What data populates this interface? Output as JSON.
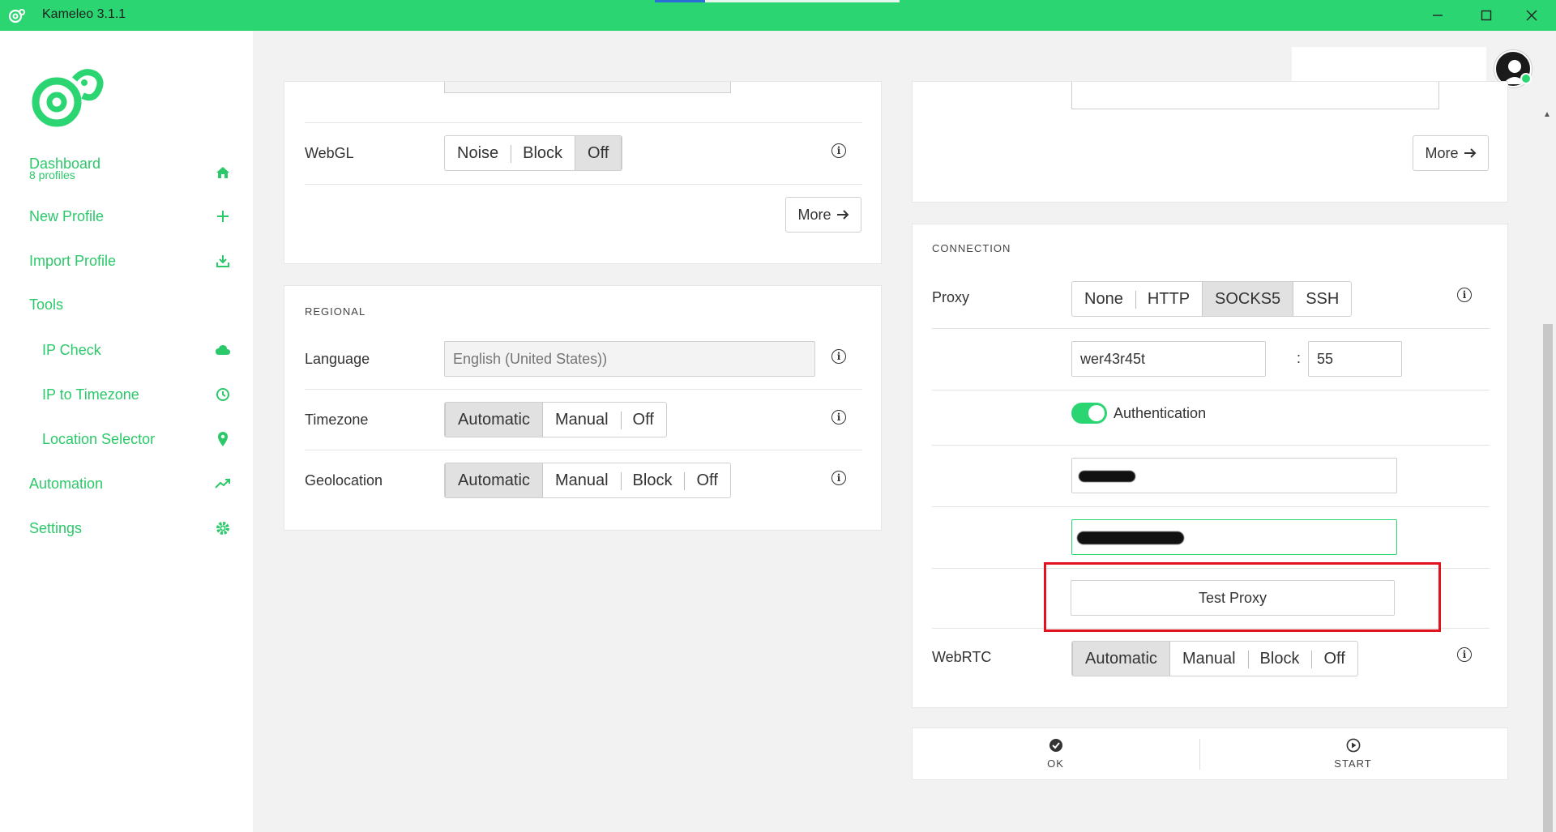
{
  "window": {
    "title": "Kameleo 3.1.1"
  },
  "sidebar": {
    "dashboard": {
      "label": "Dashboard",
      "sub": "8 profiles"
    },
    "items": [
      {
        "label": "New Profile",
        "icon": "plus-icon"
      },
      {
        "label": "Import Profile",
        "icon": "download-icon"
      },
      {
        "label": "Tools",
        "icon": ""
      },
      {
        "label": "IP Check",
        "icon": "cloud-icon"
      },
      {
        "label": "IP to Timezone",
        "icon": "clock-icon"
      },
      {
        "label": "Location Selector",
        "icon": "map-pin-icon"
      },
      {
        "label": "Automation",
        "icon": "trending-icon"
      },
      {
        "label": "Settings",
        "icon": "gear-icon"
      }
    ]
  },
  "left": {
    "webgl": {
      "label": "WebGL",
      "options": [
        "Noise",
        "Block",
        "Off"
      ],
      "selected": "Off"
    },
    "more_label": "More",
    "regional": {
      "title": "REGIONAL",
      "language": {
        "label": "Language",
        "placeholder": "English (United States))"
      },
      "timezone": {
        "label": "Timezone",
        "options": [
          "Automatic",
          "Manual",
          "Off"
        ],
        "selected": "Automatic"
      },
      "geolocation": {
        "label": "Geolocation",
        "options": [
          "Automatic",
          "Manual",
          "Block",
          "Off"
        ],
        "selected": "Automatic"
      }
    }
  },
  "right": {
    "more_label": "More",
    "connection": {
      "title": "CONNECTION",
      "proxy": {
        "label": "Proxy",
        "options": [
          "None",
          "HTTP",
          "SOCKS5",
          "SSH"
        ],
        "selected": "SOCKS5"
      },
      "host": "wer43r45t",
      "port_separator": ":",
      "port": "55",
      "authentication": {
        "label": "Authentication",
        "enabled": true
      },
      "test_proxy_label": "Test Proxy",
      "webrtc": {
        "label": "WebRTC",
        "options": [
          "Automatic",
          "Manual",
          "Block",
          "Off"
        ],
        "selected": "Automatic"
      }
    }
  },
  "actions": {
    "ok": "OK",
    "start": "START"
  },
  "colors": {
    "accent": "#2bd672",
    "highlight": "#e0131f"
  }
}
